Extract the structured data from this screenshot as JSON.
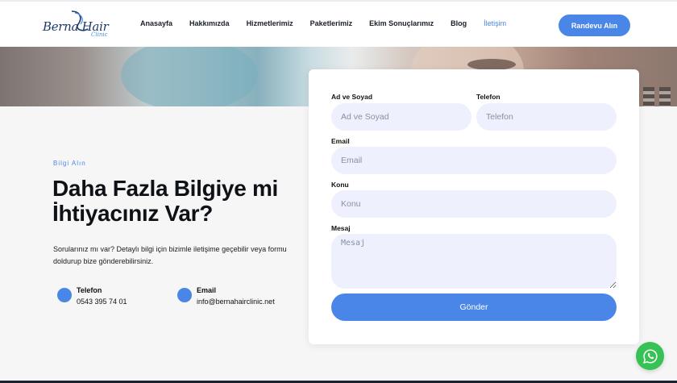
{
  "header": {
    "logo_text": "Berna Hair",
    "logo_sub": "Clinic",
    "nav": [
      {
        "label": "Anasayfa"
      },
      {
        "label": "Hakkımızda"
      },
      {
        "label": "Hizmetlerimiz"
      },
      {
        "label": "Paketlerimiz"
      },
      {
        "label": "Ekim Sonuçlarımız"
      },
      {
        "label": "Blog"
      },
      {
        "label": "İletişim",
        "active": true
      }
    ],
    "cta_label": "Randevu Alın"
  },
  "info": {
    "eyebrow": "Bilgi Alın",
    "headline": "Daha Fazla Bilgiye mi İhtiyacınız Var?",
    "description": "Sorularınız mı var? Detaylı bilgi için bizimle iletişime geçebilir veya formu doldurup bize gönderebilirsiniz.",
    "phone": {
      "label": "Telefon",
      "value": "0543 395 74 01"
    },
    "email": {
      "label": "Email",
      "value": "info@bernahairclinic.net"
    }
  },
  "form": {
    "name": {
      "label": "Ad ve Soyad",
      "placeholder": "Ad ve Soyad"
    },
    "phone": {
      "label": "Telefon",
      "placeholder": "Telefon"
    },
    "email": {
      "label": "Email",
      "placeholder": "Email"
    },
    "subject": {
      "label": "Konu",
      "placeholder": "Konu"
    },
    "message": {
      "label": "Mesaj",
      "placeholder": "Mesaj"
    },
    "submit_label": "Gönder"
  },
  "colors": {
    "accent": "#4a86e8",
    "field_bg": "#eef0fd",
    "whatsapp": "#36c254"
  },
  "icons": {
    "whatsapp": "whatsapp-icon",
    "contact": "dot-icon"
  }
}
